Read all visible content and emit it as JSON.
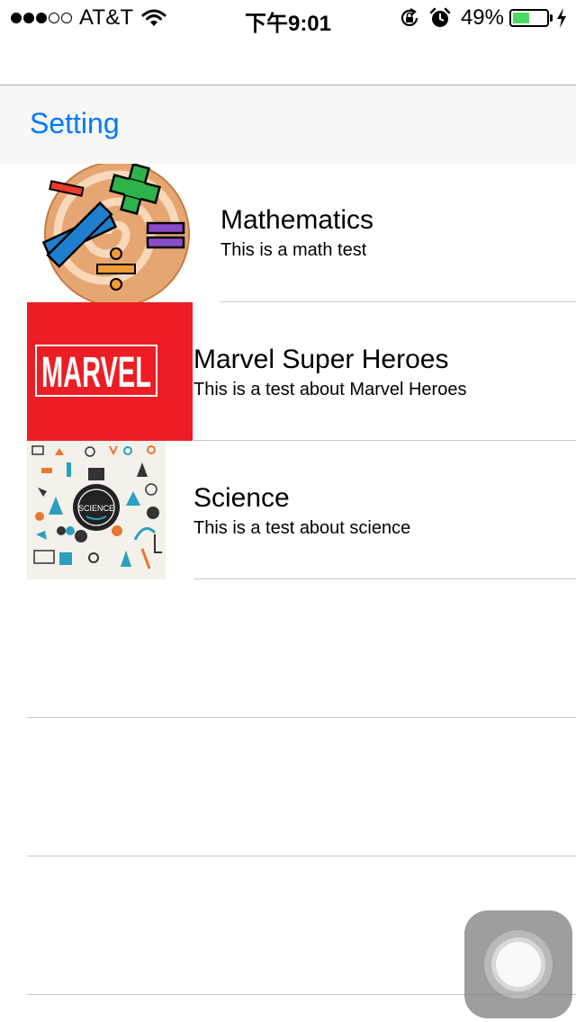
{
  "status_bar": {
    "carrier": "AT&T",
    "time": "下午9:01",
    "battery_percent_label": "49%",
    "battery_level": 0.49,
    "signal_strength": 3,
    "signal_max": 5,
    "icons": [
      "wifi-icon",
      "rotation-lock-icon",
      "alarm-icon",
      "battery-icon",
      "charging-bolt-icon"
    ]
  },
  "nav": {
    "back_label": "Setting"
  },
  "tests": [
    {
      "title": "Mathematics",
      "subtitle": "This is a math test",
      "icon": "math-symbols-icon"
    },
    {
      "title": "Marvel Super Heroes",
      "subtitle": "This is a test about Marvel Heroes",
      "icon": "marvel-logo",
      "logo_text": "MARVEL"
    },
    {
      "title": "Science",
      "subtitle": "This is a test about science",
      "icon": "science-collage-icon",
      "logo_text": "SCIENCE"
    }
  ],
  "colors": {
    "accent": "#007aff",
    "battery": "#4cd964",
    "marvel_red": "#ec1d24",
    "separator": "#c8c7cc",
    "nav_background": "#f7f7f7"
  }
}
